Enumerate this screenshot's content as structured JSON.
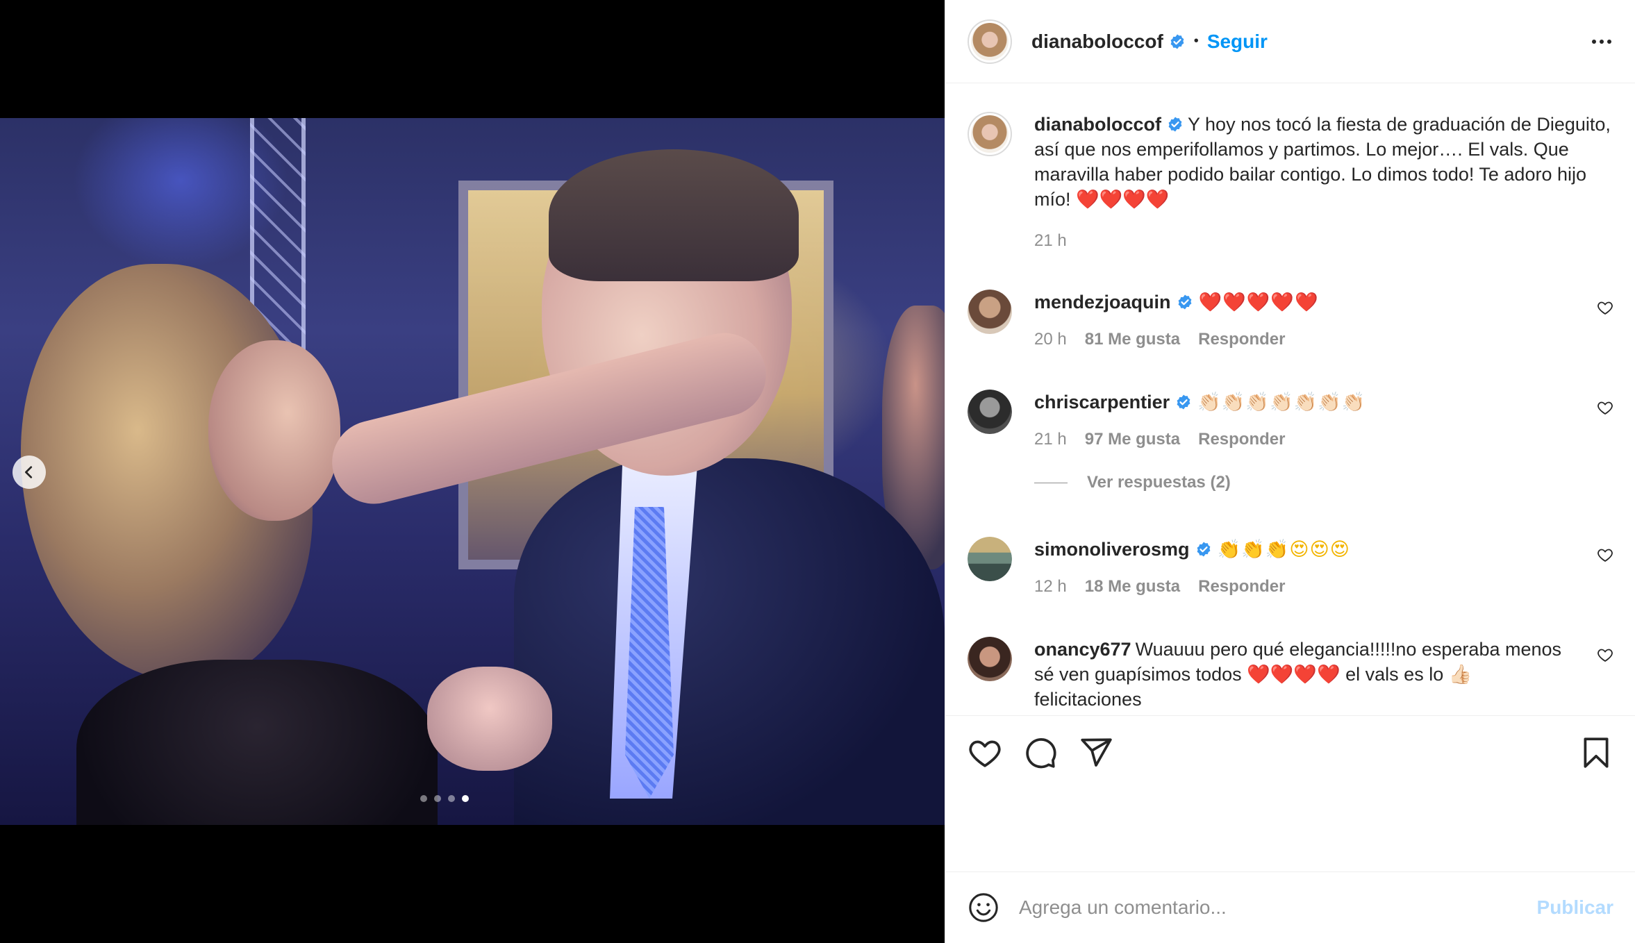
{
  "post": {
    "author": "dianaboloccof",
    "follow_label": "Seguir",
    "separator": "•",
    "caption": "Y hoy nos tocó la fiesta de graduación de Dieguito, así que nos emperifollamos y partimos. Lo mejor…. El vals. Que maravilla haber podido bailar contigo. Lo dimos todo! Te adoro hijo mío! ❤️❤️❤️❤️",
    "time": "21 h",
    "carousel": {
      "count": 4,
      "active_index": 3
    }
  },
  "comments": [
    {
      "user": "mendezjoaquin",
      "verified": true,
      "text": "❤️❤️❤️❤️❤️",
      "time": "20 h",
      "likes": "81 Me gusta",
      "reply": "Responder"
    },
    {
      "user": "chriscarpentier",
      "verified": true,
      "text": "👏🏻👏🏻👏🏻👏🏻👏🏻👏🏻👏🏻",
      "time": "21 h",
      "likes": "97 Me gusta",
      "reply": "Responder",
      "view_replies": "Ver respuestas (2)"
    },
    {
      "user": "simonoliverosmg",
      "verified": true,
      "text": "👏👏👏😍😍😍",
      "time": "12 h",
      "likes": "18 Me gusta",
      "reply": "Responder"
    },
    {
      "user": "onancy677",
      "verified": false,
      "text": "Wuauuu pero qué elegancia!!!!!no esperaba menos sé ven guapísimos todos ❤️❤️❤️❤️ el vals es lo 👍🏻 felicitaciones"
    }
  ],
  "composer": {
    "placeholder": "Agrega un comentario...",
    "publish_label": "Publicar"
  },
  "colors": {
    "link": "#0095f6",
    "verified": "#3897f0",
    "muted": "#8e8e8e",
    "publish_disabled": "#b3dbff"
  },
  "icons": [
    "chevron-left-icon",
    "verified-badge-icon",
    "more-icon",
    "heart-icon",
    "comment-icon",
    "share-icon",
    "bookmark-icon",
    "emoji-icon"
  ]
}
